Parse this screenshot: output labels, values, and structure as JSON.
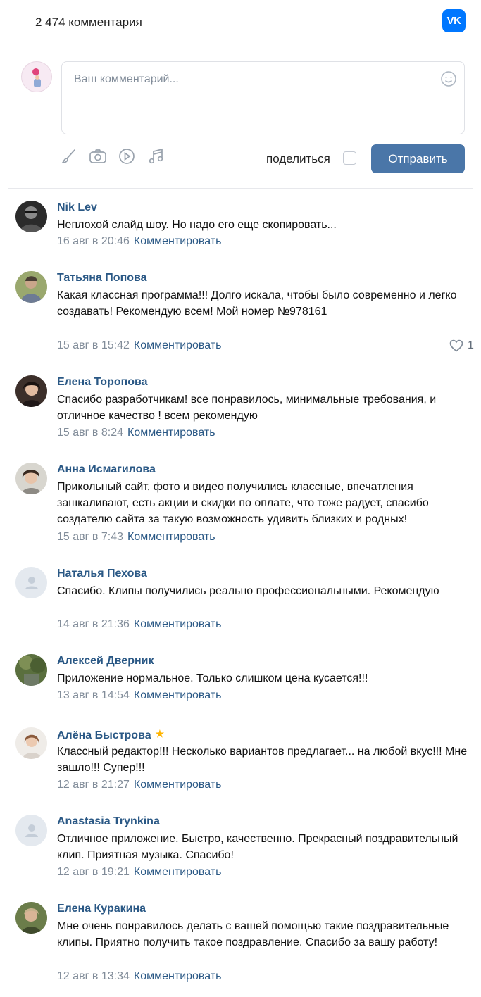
{
  "header": {
    "count": "2 474 комментария",
    "logo_text": "VK"
  },
  "composer": {
    "placeholder": "Ваш комментарий...",
    "share_label": "поделиться",
    "send_label": "Отправить",
    "tools": [
      "brush-icon",
      "camera-icon",
      "video-icon",
      "music-icon"
    ]
  },
  "comments": [
    {
      "author": "Nik Lev",
      "text": "Неплохой слайд шоу. Но надо его еще скопировать...",
      "date": "16 авг в 20:46",
      "reply": "Комментировать"
    },
    {
      "author": "Татьяна Попова",
      "text": "Какая классная программа!!! Долго искала, чтобы было современно и легко создавать! Рекомендую всем! Мой номер №978161",
      "date": "15 авг в 15:42",
      "reply": "Комментировать",
      "likes": "1"
    },
    {
      "author": "Елена Торопова",
      "text": "Спасибо разработчикам! все понравилось, минимальные требования, и отличное качество ! всем рекомендую",
      "date": "15 авг в 8:24",
      "reply": "Комментировать"
    },
    {
      "author": "Анна Исмагилова",
      "text": "Прикольный сайт, фото и видео получились классные, впечатления зашкаливают, есть акции и скидки по оплате, что тоже радует, спасибо создателю сайта за такую возможность удивить близких и родных!",
      "date": "15 авг в 7:43",
      "reply": "Комментировать"
    },
    {
      "author": "Наталья Пехова",
      "text": "Спасибо. Клипы получились реально профессиональными. Рекомендую",
      "date": "14 авг в 21:36",
      "reply": "Комментировать"
    },
    {
      "author": "Алексей Дверник",
      "text": "Приложение нормальное. Только слишком цена кусается!!!",
      "date": "13 авг в 14:54",
      "reply": "Комментировать"
    },
    {
      "author": "Алёна Быстрова",
      "text": "Классный редактор!!! Несколько вариантов предлагает... на любой вкус!!! Мне зашло!!! Супер!!!",
      "date": "12 авг в 21:27",
      "reply": "Комментировать",
      "badge": "★"
    },
    {
      "author": "Anastasia Trynkina",
      "text": "Отличное приложение. Быстро, качественно. Прекрасный поздравительный клип. Приятная музыка. Спасибо!",
      "date": "12 авг в 19:21",
      "reply": "Комментировать"
    },
    {
      "author": "Елена Куракина",
      "text": "Мне очень понравилось делать с вашей помощью такие поздравительные клипы. Приятно получить такое поздравление. Спасибо за вашу работу!",
      "date": "12 авг в 13:34",
      "reply": "Комментировать"
    }
  ],
  "colors": {
    "link": "#2a5885",
    "meta": "#818c99",
    "button": "#4a76a8",
    "vk_brand": "#0077ff"
  }
}
